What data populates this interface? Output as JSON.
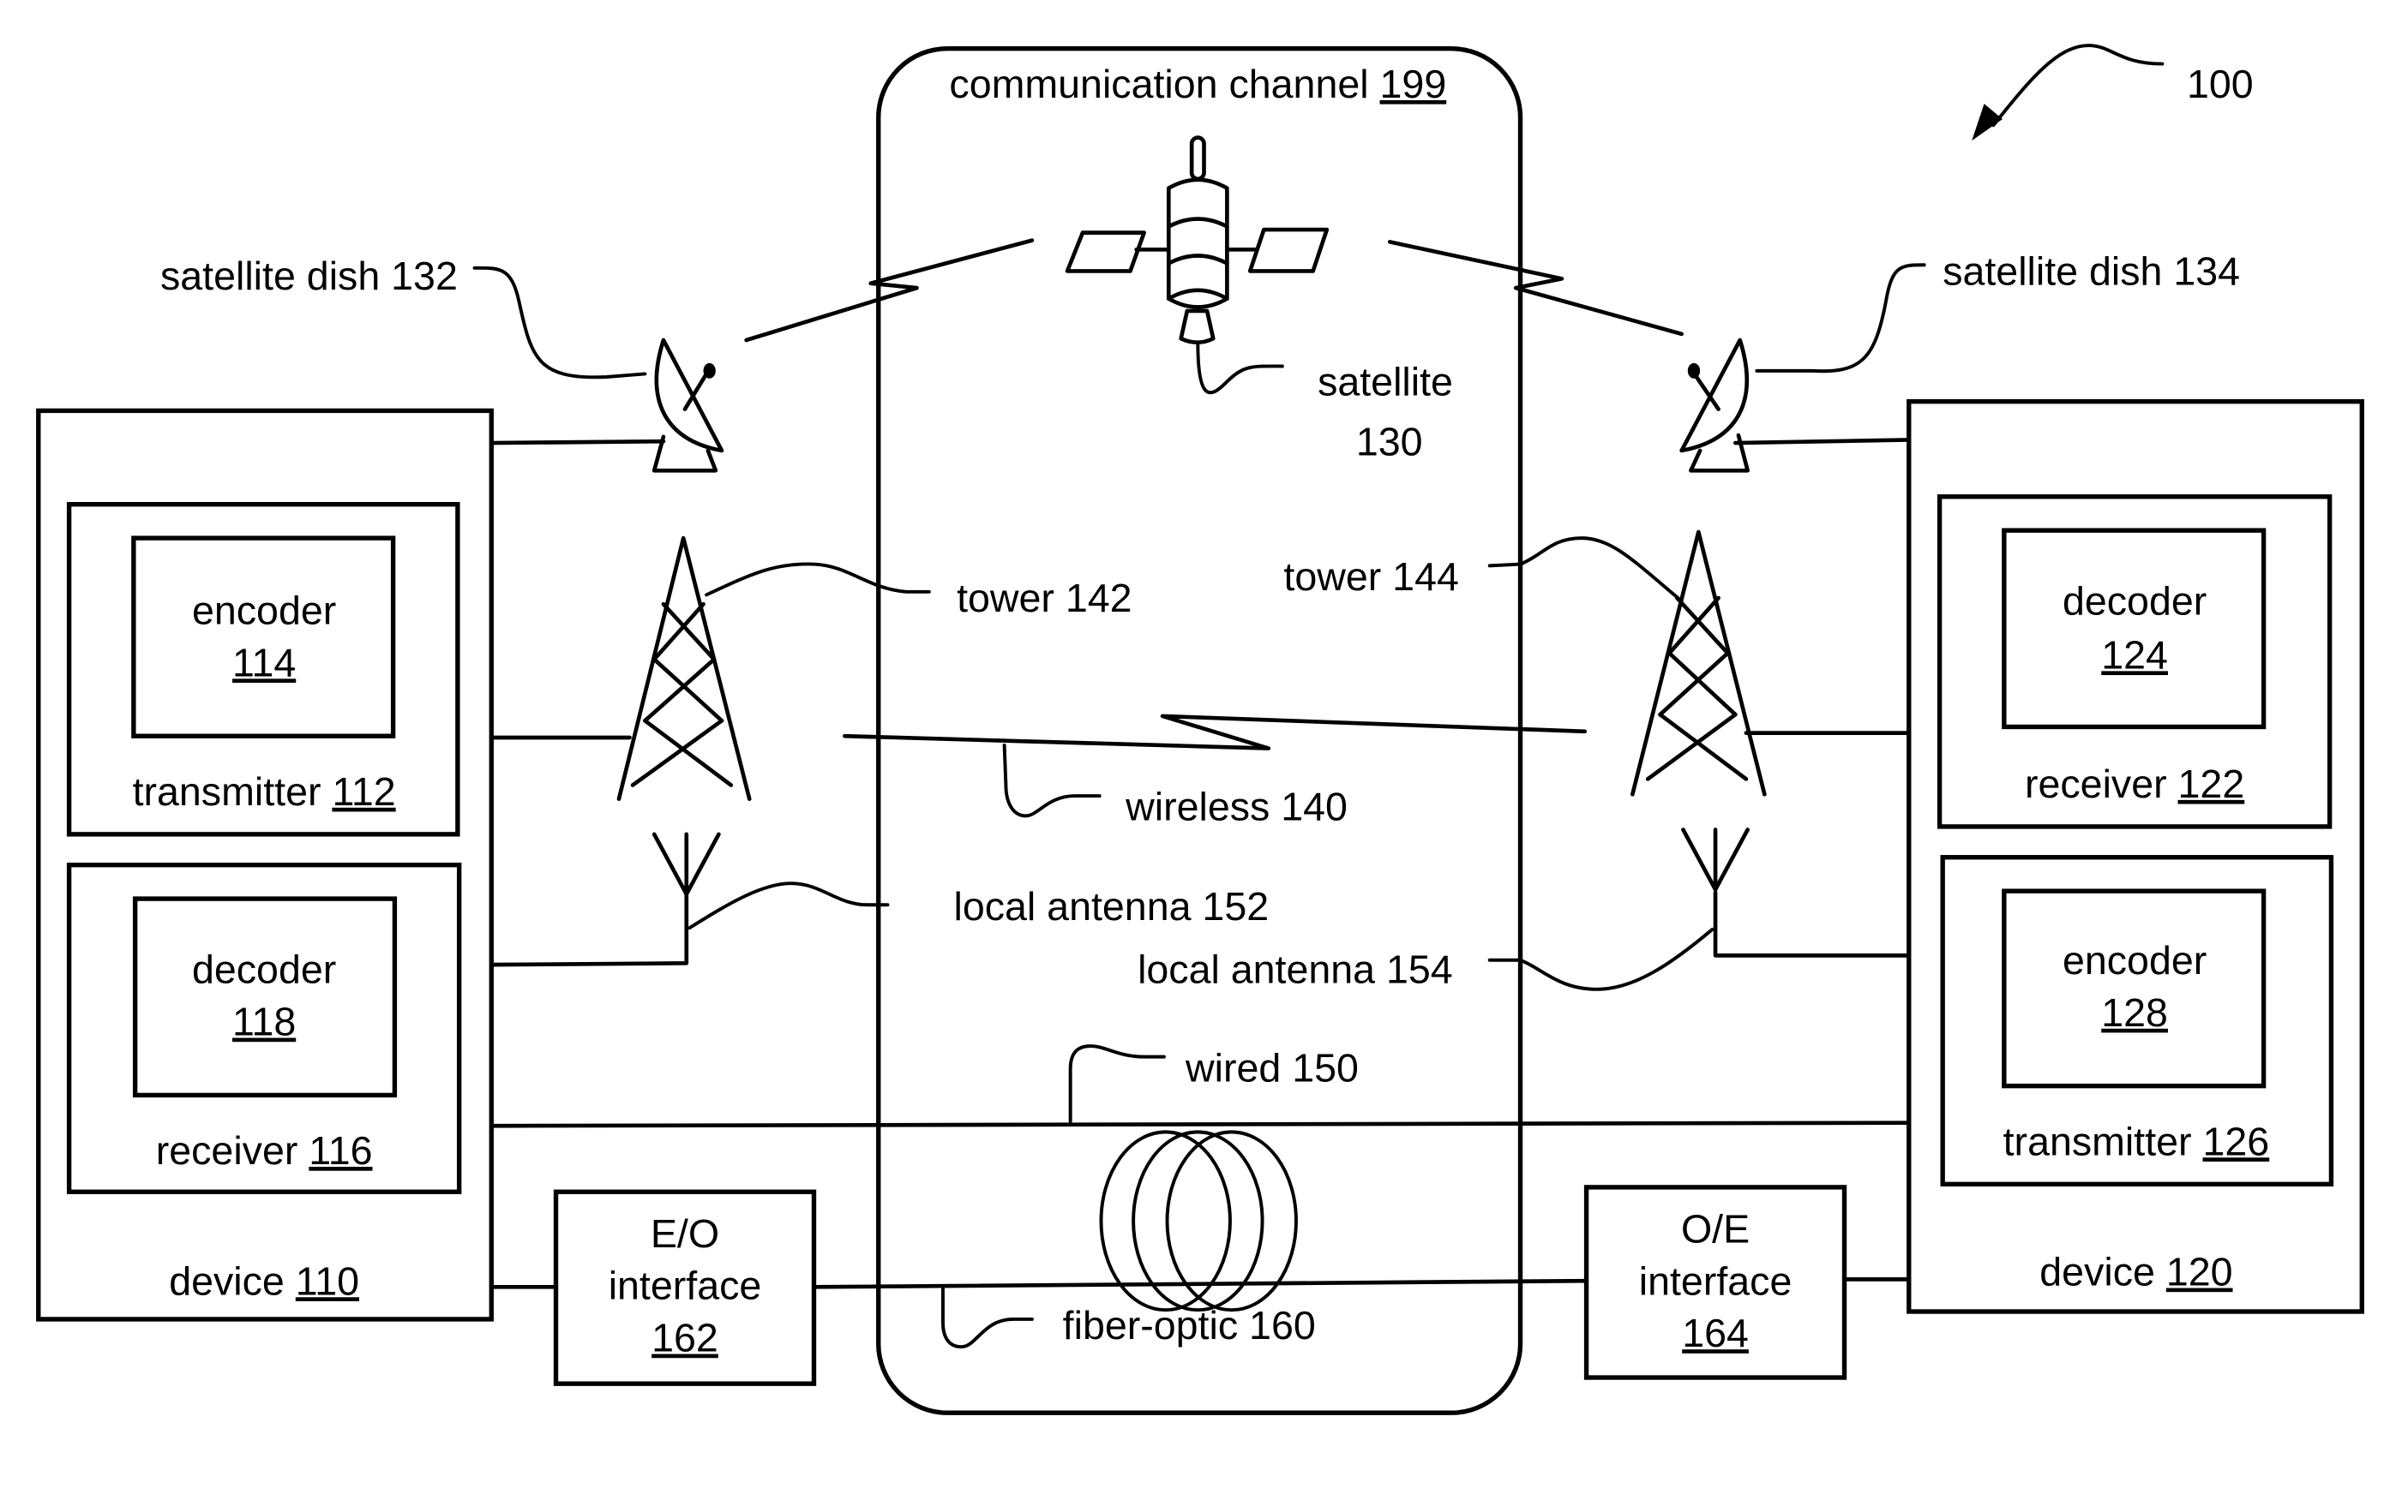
{
  "figure": {
    "ref": "100",
    "channel": {
      "label": "communication channel",
      "ref": "199"
    },
    "device_left": {
      "label": "device",
      "ref": "110",
      "transmitter": {
        "label": "transmitter",
        "ref": "112",
        "encoder": {
          "label": "encoder",
          "ref": "114"
        }
      },
      "receiver": {
        "label": "receiver",
        "ref": "116",
        "decoder": {
          "label": "decoder",
          "ref": "118"
        }
      }
    },
    "device_right": {
      "label": "device",
      "ref": "120",
      "receiver": {
        "label": "receiver",
        "ref": "122",
        "decoder": {
          "label": "decoder",
          "ref": "124"
        }
      },
      "transmitter": {
        "label": "transmitter",
        "ref": "126",
        "encoder": {
          "label": "encoder",
          "ref": "128"
        }
      }
    },
    "labels": {
      "satellite_dish_132": "satellite dish 132",
      "satellite_dish_134": "satellite dish 134",
      "satellite_line1": "satellite",
      "satellite_line2": "130",
      "tower_142": "tower 142",
      "tower_144": "tower 144",
      "wireless_140": "wireless 140",
      "local_antenna_152": "local antenna 152",
      "local_antenna_154": "local antenna 154",
      "wired_150": "wired 150",
      "fiber_optic_160": "fiber-optic 160"
    },
    "eo_interface": {
      "line1": "E/O",
      "line2": "interface",
      "ref": "162"
    },
    "oe_interface": {
      "line1": "O/E",
      "line2": "interface",
      "ref": "164"
    }
  }
}
